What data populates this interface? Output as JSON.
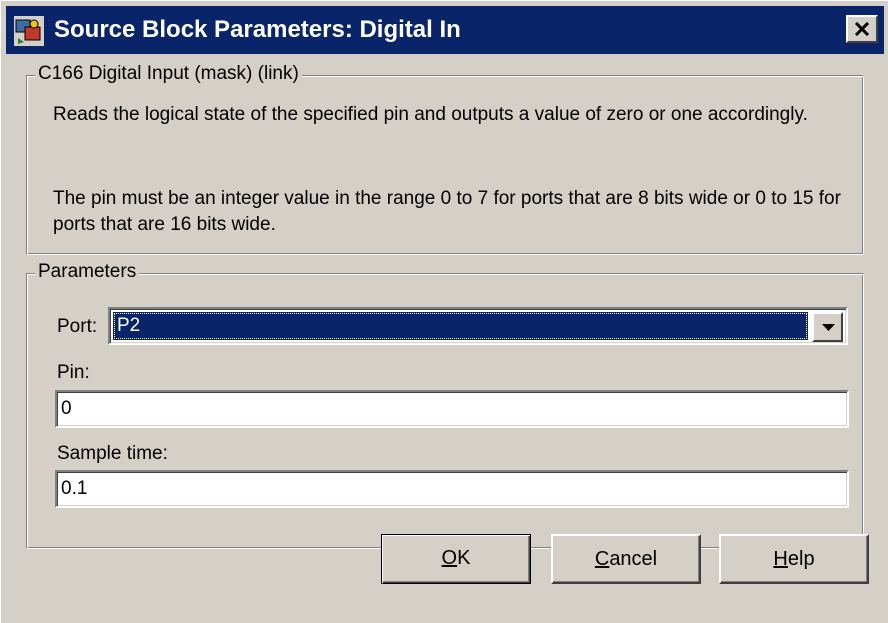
{
  "window": {
    "title": "Source Block Parameters: Digital In",
    "app_icon": "simulink-block-icon",
    "close_icon": "close-icon"
  },
  "description_group": {
    "legend": "C166 Digital Input (mask) (link)",
    "paragraph1": "Reads the logical state of the specified pin and outputs a value of zero or one accordingly.",
    "paragraph2": "The pin must be an integer value in the range 0 to 7 for ports that are 8 bits wide or 0 to 15 for ports that are 16 bits wide."
  },
  "parameters_group": {
    "legend": "Parameters",
    "port": {
      "label": "Port:",
      "value": "P2"
    },
    "pin": {
      "label": "Pin:",
      "value": "0"
    },
    "sample_time": {
      "label": "Sample time:",
      "value": "0.1"
    }
  },
  "buttons": {
    "ok": {
      "accel": "O",
      "rest": "K"
    },
    "cancel": {
      "accel": "C",
      "rest": "ancel"
    },
    "help": {
      "accel": "H",
      "rest": "elp"
    }
  },
  "colors": {
    "titlebar": "#0a246a",
    "face": "#d4d0c8",
    "selection": "#0a246a"
  }
}
